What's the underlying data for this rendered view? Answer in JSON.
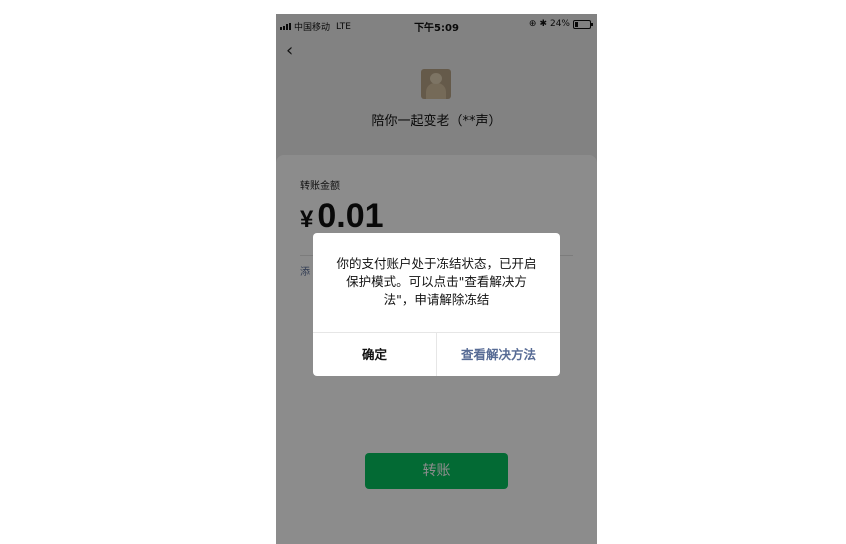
{
  "status_bar": {
    "carrier": "中国移动",
    "network": "LTE",
    "time": "下午5:09",
    "battery_percent": "24%",
    "battery_level": 0.24
  },
  "header": {
    "back_icon": "chevron-left-icon",
    "recipient_name": "陪你一起变老（**声）"
  },
  "transfer": {
    "amount_label": "转账金额",
    "currency": "¥",
    "amount": "0.01",
    "add_note": "添",
    "submit_label": "转账",
    "accent_color": "#07c160"
  },
  "dialog": {
    "message": "你的支付账户处于冻结状态，已开启保护模式。可以点击\"查看解决方法\"，申请解除冻结",
    "confirm_label": "确定",
    "view_solution_label": "查看解决方法",
    "link_color": "#576b95"
  }
}
